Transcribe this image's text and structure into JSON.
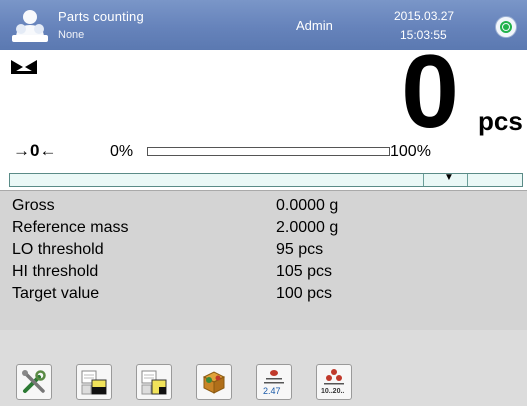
{
  "header": {
    "mode_name": "Parts counting",
    "mode_sub": "None",
    "user": "Admin",
    "date": "2015.03.27",
    "time": "15:03:55",
    "icons": [
      "user-icon",
      "status-icon"
    ]
  },
  "reading": {
    "value": "0",
    "unit": "pcs",
    "zero_indicator": "→0←",
    "scale_min": "0%",
    "scale_max": "100%",
    "scale_fill_fraction": 0
  },
  "info": [
    {
      "label": "Gross",
      "value": "0.0000 g"
    },
    {
      "label": "Reference mass",
      "value": "2.0000 g"
    },
    {
      "label": "LO threshold",
      "value": "95 pcs"
    },
    {
      "label": "HI threshold",
      "value": "105 pcs"
    },
    {
      "label": "Target value",
      "value": "100 pcs"
    }
  ],
  "toolbar": {
    "icons": [
      "settings-icon",
      "tare-icon",
      "tare-edit-icon",
      "product-database-icon",
      "sample-mass-icon",
      "sample-count-icon"
    ],
    "sample_mass_value": "2.47",
    "sample_count_value": "10..20.."
  },
  "colors": {
    "header": "#6683bb",
    "status_green": "#21b24a",
    "panel": "#d4d4d4",
    "bar_fill": "#eaf8f6"
  }
}
